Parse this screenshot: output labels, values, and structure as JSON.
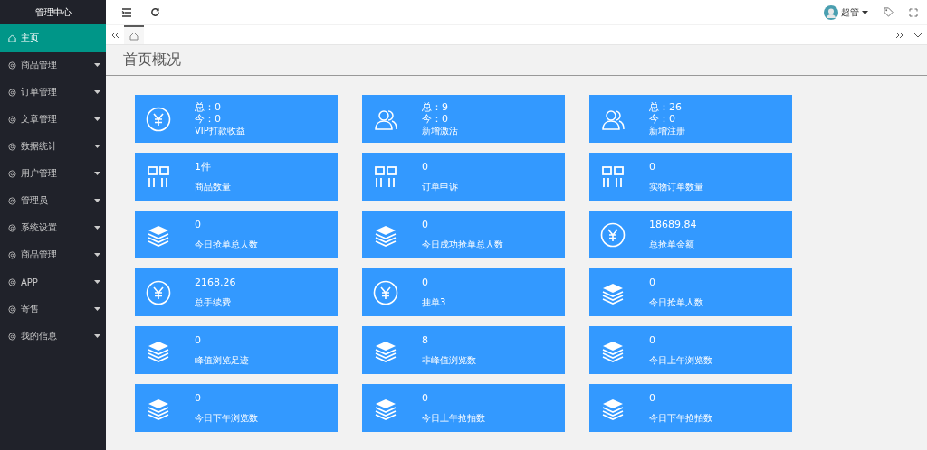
{
  "sidebar": {
    "title": "管理中心",
    "items": [
      {
        "kind": "home",
        "label": "主页",
        "selected": true
      },
      {
        "kind": "menu",
        "label": "商品管理",
        "selected": false
      },
      {
        "kind": "menu",
        "label": "订单管理",
        "selected": false
      },
      {
        "kind": "menu",
        "label": "文章管理",
        "selected": false
      },
      {
        "kind": "menu",
        "label": "数据统计",
        "selected": false
      },
      {
        "kind": "menu",
        "label": "用户管理",
        "selected": false
      },
      {
        "kind": "menu",
        "label": "管理员",
        "selected": false
      },
      {
        "kind": "menu",
        "label": "系统设置",
        "selected": false
      },
      {
        "kind": "menu",
        "label": "商品管理",
        "selected": false
      },
      {
        "kind": "menu",
        "label": "APP",
        "selected": false
      },
      {
        "kind": "menu",
        "label": "寄售",
        "selected": false
      },
      {
        "kind": "menu",
        "label": "我的信息",
        "selected": false
      }
    ]
  },
  "header": {
    "user": "超管"
  },
  "tabs": [
    {
      "kind": "home",
      "selected": true
    }
  ],
  "page_title": "首页概况",
  "cards": [
    {
      "kind": "yen",
      "total": "总：0",
      "today": "今：0",
      "label": "VIP打款收益"
    },
    {
      "kind": "users",
      "total": "总：9",
      "today": "今：0",
      "label": "新增激活"
    },
    {
      "kind": "users",
      "total": "总：26",
      "today": "今：0",
      "label": "新增注册"
    },
    {
      "kind": "grid",
      "value": "1件",
      "label": "商品数量"
    },
    {
      "kind": "grid",
      "value": "0",
      "label": "订单申诉"
    },
    {
      "kind": "grid",
      "value": "0",
      "label": "实物订单数量"
    },
    {
      "kind": "layers",
      "value": "0",
      "label": "今日抢单总人数"
    },
    {
      "kind": "layers",
      "value": "0",
      "label": "今日成功抢单总人数"
    },
    {
      "kind": "yen",
      "value": "18689.84",
      "label": "总抢单金额"
    },
    {
      "kind": "yen",
      "value": "2168.26",
      "label": "总手续费"
    },
    {
      "kind": "yen",
      "value": "0",
      "label": "挂单3"
    },
    {
      "kind": "layers",
      "value": "0",
      "label": "今日抢单人数"
    },
    {
      "kind": "layers",
      "value": "0",
      "label": "峰值浏览足迹"
    },
    {
      "kind": "layers",
      "value": "8",
      "label": "非峰值浏览数"
    },
    {
      "kind": "layers",
      "value": "0",
      "label": "今日上午浏览数"
    },
    {
      "kind": "layers",
      "value": "0",
      "label": "今日下午浏览数"
    },
    {
      "kind": "layers",
      "value": "0",
      "label": "今日上午抢拍数"
    },
    {
      "kind": "layers",
      "value": "0",
      "label": "今日下午抢拍数"
    }
  ]
}
